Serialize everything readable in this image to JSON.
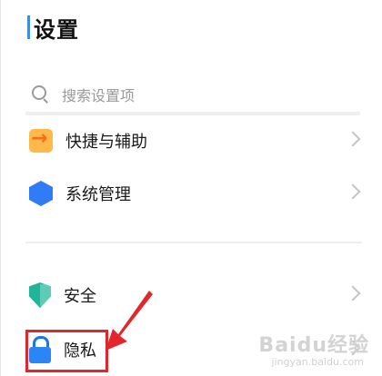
{
  "title": "设置",
  "search": {
    "placeholder": "搜索设置项"
  },
  "rows": [
    {
      "label": "快捷与辅助",
      "icon": "shortcut-arrow-icon"
    },
    {
      "label": "系统管理",
      "icon": "hexagon-icon"
    },
    {
      "label": "安全",
      "icon": "shield-icon"
    },
    {
      "label": "隐私",
      "icon": "lock-icon"
    }
  ],
  "annotation": {
    "color": "#e2262b"
  },
  "watermark": {
    "text": "Baidu经验",
    "sub": "jingyan.baidu.com"
  }
}
